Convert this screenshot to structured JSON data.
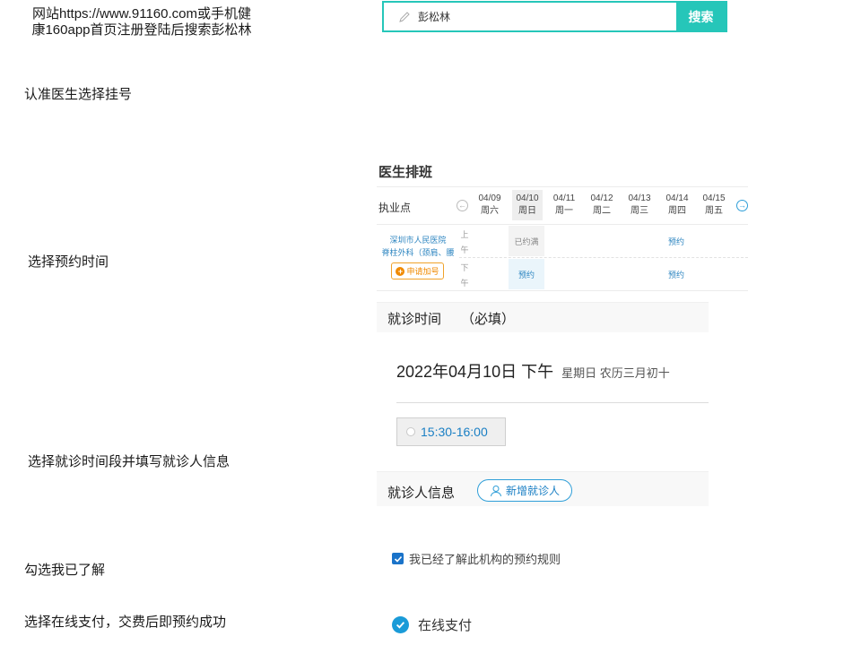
{
  "steps": {
    "step1_line1": "网站https://www.91160.com或手机健",
    "step1_line2": "康160app首页注册登陆后搜索彭松林",
    "step2": "认准医生选择挂号",
    "step3": "选择预约时间",
    "step4": "选择就诊时间段并填写就诊人信息",
    "step5": "勾选我已了解",
    "step6": "选择在线支付，交费后即预约成功"
  },
  "search": {
    "value": "彭松林",
    "button_label": "搜索",
    "icon": "pencil-icon",
    "accent_color": "#26c6b9"
  },
  "schedule": {
    "title": "医生排班",
    "location_label": "执业点",
    "days": [
      {
        "date": "04/09",
        "weekday": "周六"
      },
      {
        "date": "04/10",
        "weekday": "周日"
      },
      {
        "date": "04/11",
        "weekday": "周一"
      },
      {
        "date": "04/12",
        "weekday": "周二"
      },
      {
        "date": "04/13",
        "weekday": "周三"
      },
      {
        "date": "04/14",
        "weekday": "周四"
      },
      {
        "date": "04/15",
        "weekday": "周五"
      }
    ],
    "hospital_line1": "深圳市人民医院",
    "hospital_line2": "脊柱外科（颈肩、腰",
    "add_number_label": "申请加号",
    "am_label_1": "上",
    "am_label_2": "午",
    "pm_label_1": "下",
    "pm_label_2": "午",
    "am_slots": {
      "sun": "已约满",
      "thu": "预约"
    },
    "pm_slots": {
      "sun": "预约",
      "thu": "预约"
    }
  },
  "visit": {
    "title": "就诊时间",
    "required": "（必填）",
    "date_main": "2022年04月10日 下午",
    "date_sub": "星期日  农历三月初十",
    "time_slot": "15:30-16:00"
  },
  "patient": {
    "title": "就诊人信息",
    "add_button": "新增就诊人"
  },
  "agreement": {
    "label": "我已经了解此机构的预约规则",
    "checked": true
  },
  "payment": {
    "label": "在线支付",
    "selected": true
  }
}
